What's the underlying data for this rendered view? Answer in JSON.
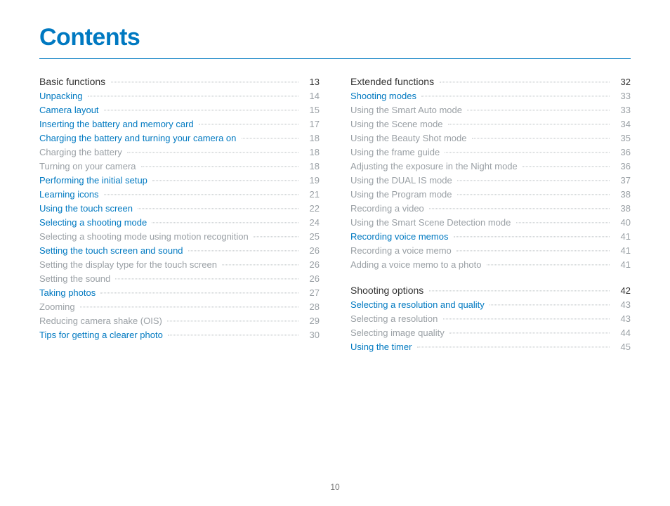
{
  "title": "Contents",
  "page_number": "10",
  "left": [
    {
      "label": "Basic functions",
      "page": "13",
      "kind": "head"
    },
    {
      "label": "Unpacking",
      "page": "14",
      "kind": "link"
    },
    {
      "label": "Camera layout",
      "page": "15",
      "kind": "link"
    },
    {
      "label": "Inserting the battery and memory card",
      "page": "17",
      "kind": "link"
    },
    {
      "label": "Charging the battery and turning your camera on",
      "page": "18",
      "kind": "link"
    },
    {
      "label": "Charging the battery",
      "page": "18",
      "kind": "sub"
    },
    {
      "label": "Turning on your camera",
      "page": "18",
      "kind": "sub"
    },
    {
      "label": "Performing the initial setup",
      "page": "19",
      "kind": "link"
    },
    {
      "label": "Learning icons",
      "page": "21",
      "kind": "link"
    },
    {
      "label": "Using the touch screen",
      "page": "22",
      "kind": "link"
    },
    {
      "label": "Selecting a shooting mode",
      "page": "24",
      "kind": "link"
    },
    {
      "label": "Selecting a shooting mode using motion recognition",
      "page": "25",
      "kind": "sub"
    },
    {
      "label": "Setting the touch screen and sound",
      "page": "26",
      "kind": "link"
    },
    {
      "label": "Setting the display type for the touch screen",
      "page": "26",
      "kind": "sub"
    },
    {
      "label": "Setting the sound",
      "page": "26",
      "kind": "sub"
    },
    {
      "label": "Taking photos",
      "page": "27",
      "kind": "link"
    },
    {
      "label": "Zooming",
      "page": "28",
      "kind": "sub"
    },
    {
      "label": "Reducing camera shake (OIS)",
      "page": "29",
      "kind": "sub"
    },
    {
      "label": "Tips for getting a clearer photo",
      "page": "30",
      "kind": "link"
    }
  ],
  "right": [
    {
      "label": "Extended functions",
      "page": "32",
      "kind": "head"
    },
    {
      "label": "Shooting modes",
      "page": "33",
      "kind": "link"
    },
    {
      "label": "Using the Smart Auto mode",
      "page": "33",
      "kind": "sub"
    },
    {
      "label": "Using the Scene mode",
      "page": "34",
      "kind": "sub"
    },
    {
      "label": "Using the Beauty Shot mode",
      "page": "35",
      "kind": "sub"
    },
    {
      "label": "Using the frame guide",
      "page": "36",
      "kind": "sub"
    },
    {
      "label": "Adjusting the exposure in the Night mode",
      "page": "36",
      "kind": "sub"
    },
    {
      "label": "Using the DUAL IS mode",
      "page": "37",
      "kind": "sub"
    },
    {
      "label": "Using the Program mode",
      "page": "38",
      "kind": "sub"
    },
    {
      "label": "Recording a video",
      "page": "38",
      "kind": "sub"
    },
    {
      "label": "Using the Smart Scene Detection mode",
      "page": "40",
      "kind": "sub"
    },
    {
      "label": "Recording voice memos",
      "page": "41",
      "kind": "link"
    },
    {
      "label": "Recording a voice memo",
      "page": "41",
      "kind": "sub"
    },
    {
      "label": "Adding a voice memo to a photo",
      "page": "41",
      "kind": "sub"
    },
    {
      "kind": "spacer"
    },
    {
      "label": "Shooting options",
      "page": "42",
      "kind": "head"
    },
    {
      "label": "Selecting a resolution and quality",
      "page": "43",
      "kind": "link"
    },
    {
      "label": "Selecting a resolution",
      "page": "43",
      "kind": "sub"
    },
    {
      "label": "Selecting image quality",
      "page": "44",
      "kind": "sub"
    },
    {
      "label": "Using the timer",
      "page": "45",
      "kind": "link"
    }
  ]
}
